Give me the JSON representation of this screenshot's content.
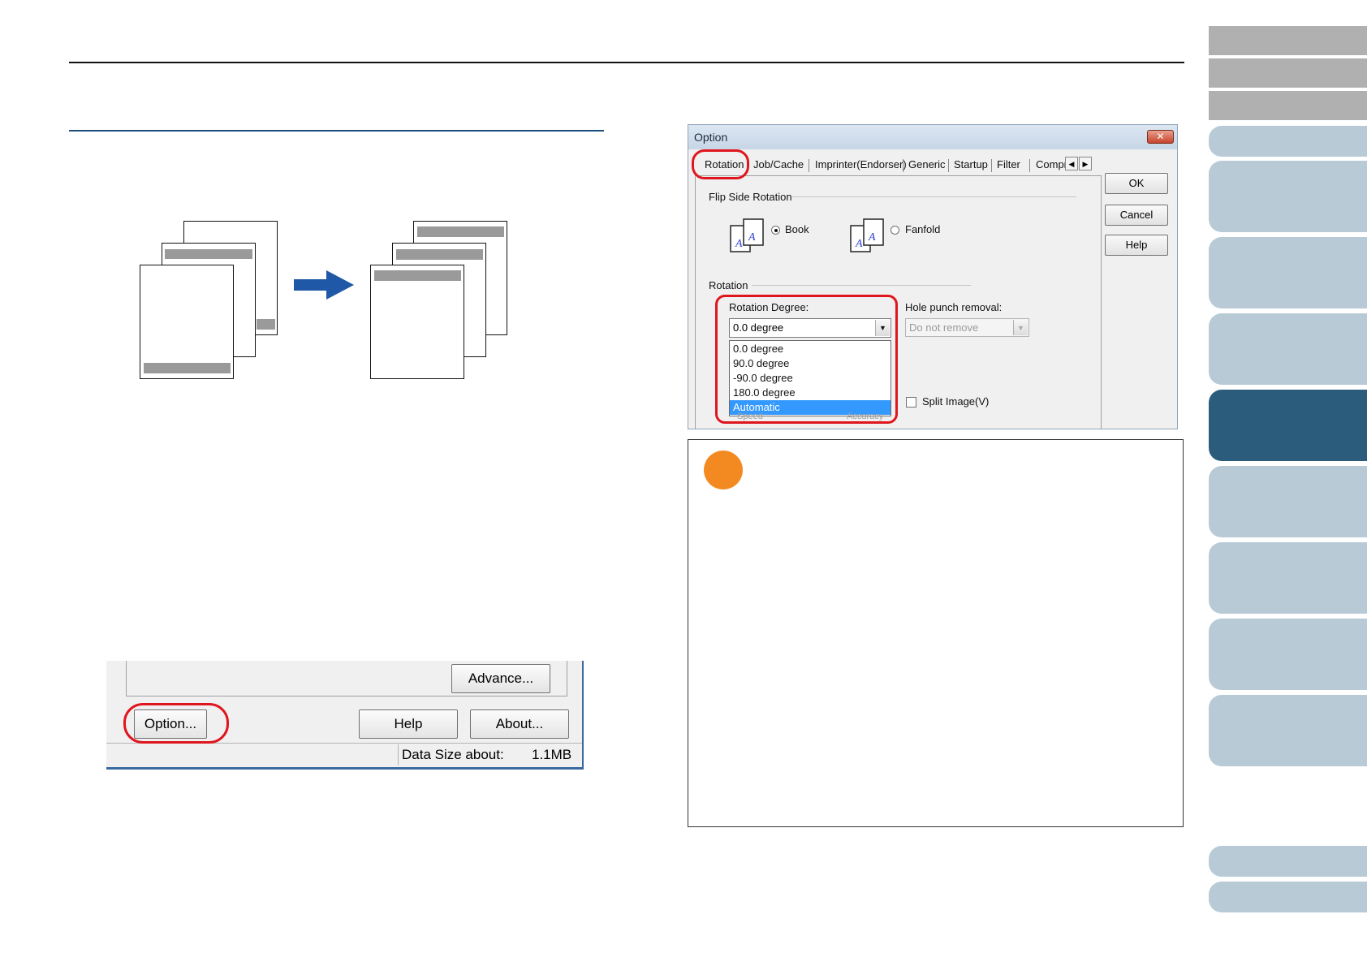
{
  "dialog": {
    "title": "Option",
    "close_glyph": "✕",
    "tabs": [
      "Rotation",
      "Job/Cache",
      "Imprinter(Endorser)",
      "Generic",
      "Startup",
      "Filter",
      "Compr"
    ],
    "tab_scroll_left": "◀",
    "tab_scroll_right": "▶",
    "buttons": {
      "ok": "OK",
      "cancel": "Cancel",
      "help": "Help"
    },
    "flip_side_rotation": {
      "label": "Flip Side Rotation",
      "book": "Book",
      "fanfold": "Fanfold",
      "selected": "Book"
    },
    "rotation": {
      "label": "Rotation",
      "degree_label": "Rotation Degree:",
      "degree_value": "0.0 degree",
      "options": [
        "0.0 degree",
        "90.0 degree",
        "-90.0 degree",
        "180.0 degree",
        "Automatic"
      ],
      "highlighted_option": "Automatic",
      "hole_punch_label": "Hole punch removal:",
      "hole_punch_value": "Do not remove",
      "split_image": "Split Image(V)",
      "slider_left": "Speed",
      "slider_right": "Accuracy"
    }
  },
  "bottom_dialog": {
    "advance": "Advance...",
    "option": "Option...",
    "help": "Help",
    "about": "About...",
    "data_size_label": "Data Size about:",
    "data_size_value": "1.1MB"
  },
  "colors": {
    "accent_red": "#e0161e",
    "nav_active": "#2b5c7c",
    "nav_inactive": "#b8cad6",
    "arrow_blue": "#1f58a6",
    "note_icon": "#f28a21"
  },
  "icons": [
    "arrow-right-icon",
    "book-flip-icon",
    "fanfold-flip-icon",
    "close-icon",
    "note-icon"
  ]
}
